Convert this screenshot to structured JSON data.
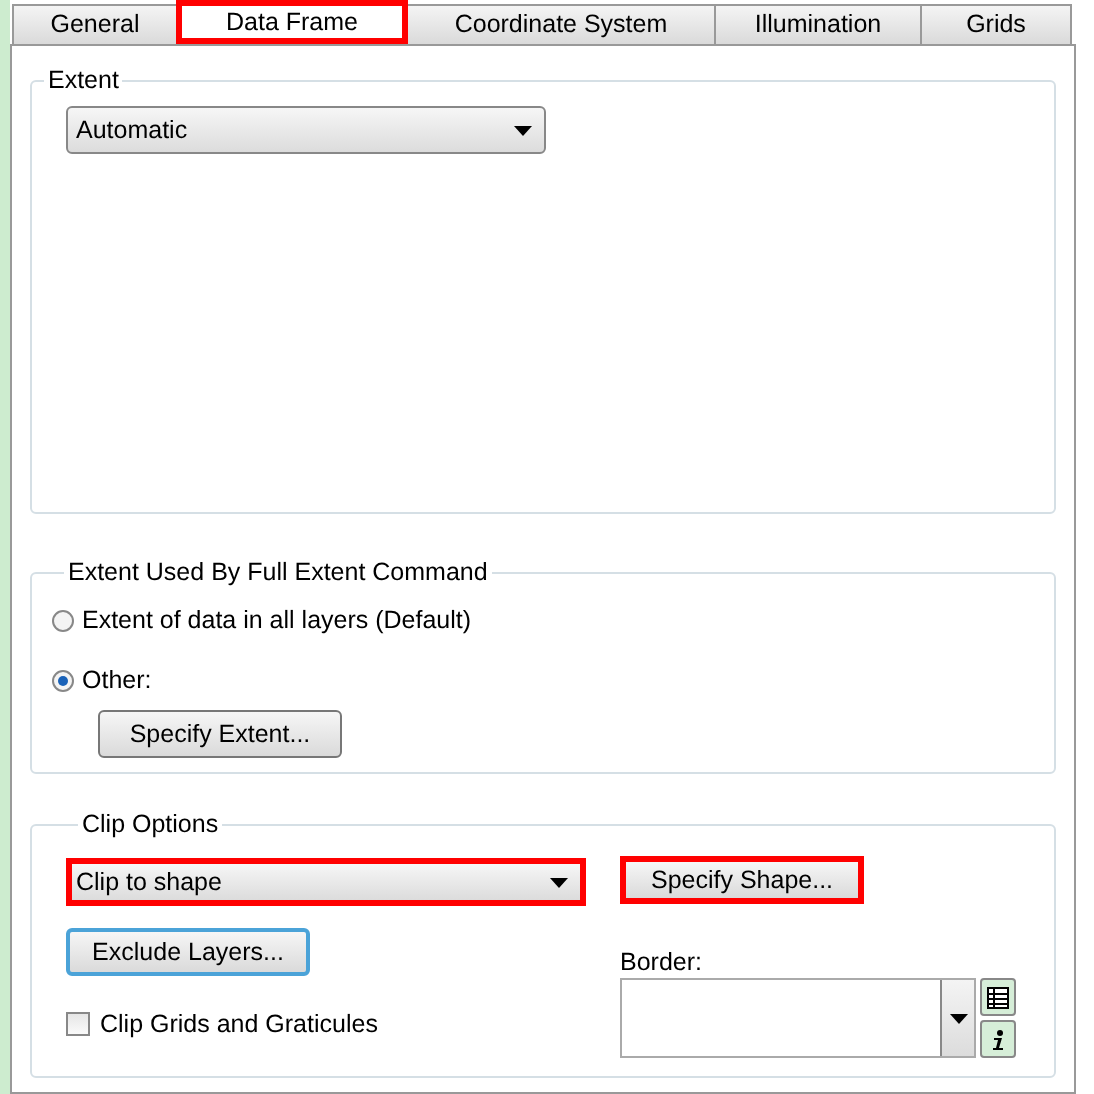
{
  "tabs": [
    {
      "label": "General",
      "selected": false,
      "highlighted": false
    },
    {
      "label": "Data Frame",
      "selected": true,
      "highlighted": true
    },
    {
      "label": "Coordinate System",
      "selected": false,
      "highlighted": false
    },
    {
      "label": "Illumination",
      "selected": false,
      "highlighted": false
    },
    {
      "label": "Grids",
      "selected": false,
      "highlighted": false
    }
  ],
  "extent": {
    "title": "Extent",
    "dropdown": {
      "value": "Automatic"
    }
  },
  "full_extent": {
    "title": "Extent Used By Full Extent Command",
    "options": [
      {
        "label": "Extent of data in all layers (Default)",
        "selected": false
      },
      {
        "label": "Other:",
        "selected": true
      }
    ],
    "button": {
      "label": "Specify Extent..."
    }
  },
  "clip": {
    "title": "Clip Options",
    "dropdown": {
      "value": "Clip to shape",
      "highlighted": true
    },
    "shape_button": {
      "label": "Specify Shape...",
      "highlighted": true
    },
    "exclude_button": {
      "label": "Exclude Layers...",
      "focused": true
    },
    "checkbox": {
      "label": "Clip Grids and Graticules",
      "checked": false
    },
    "border": {
      "label": "Border:"
    }
  }
}
